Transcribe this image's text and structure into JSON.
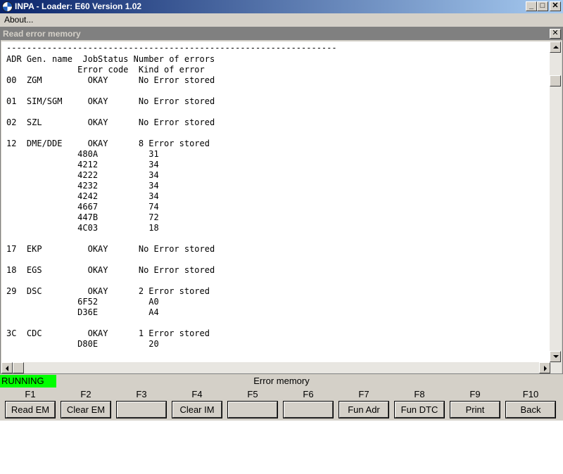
{
  "window": {
    "title": "INPA - Loader:  E60 Version 1.02",
    "min_glyph": "_",
    "max_glyph": "□",
    "close_glyph": "✕"
  },
  "menu": {
    "about": "About..."
  },
  "child": {
    "title": "Read error memory",
    "close_glyph": "✕"
  },
  "report": {
    "divider": "-----------------------------------------------------------------",
    "header1": "ADR Gen. name  JobStatus Number of errors",
    "header2": "              Error code  Kind of error",
    "lines": [
      "00  ZGM         OKAY      No Error stored",
      "01  SIM/SGM     OKAY      No Error stored",
      "02  SZL         OKAY      No Error stored",
      "12  DME/DDE     OKAY      8 Error stored",
      "              480A          31",
      "              4212          34",
      "              4222          34",
      "              4232          34",
      "              4242          34",
      "              4667          74",
      "              447B          72",
      "              4C03          18",
      "17  EKP         OKAY      No Error stored",
      "18  EGS         OKAY      No Error stored",
      "29  DSC         OKAY      2 Error stored",
      "              6F52          A0",
      "              D36E          A4",
      "3C  CDC         OKAY      1 Error stored",
      "              D80E          20"
    ]
  },
  "status": {
    "state": "RUNNING",
    "title": "Error memory",
    "running_color": "#00ff00"
  },
  "fkeys": [
    {
      "key": "F1",
      "label": "Read EM"
    },
    {
      "key": "F2",
      "label": "Clear EM"
    },
    {
      "key": "F3",
      "label": ""
    },
    {
      "key": "F4",
      "label": "Clear IM"
    },
    {
      "key": "F5",
      "label": ""
    },
    {
      "key": "F6",
      "label": ""
    },
    {
      "key": "F7",
      "label": "Fun Adr"
    },
    {
      "key": "F8",
      "label": "Fun DTC"
    },
    {
      "key": "F9",
      "label": "Print"
    },
    {
      "key": "F10",
      "label": "Back"
    }
  ]
}
